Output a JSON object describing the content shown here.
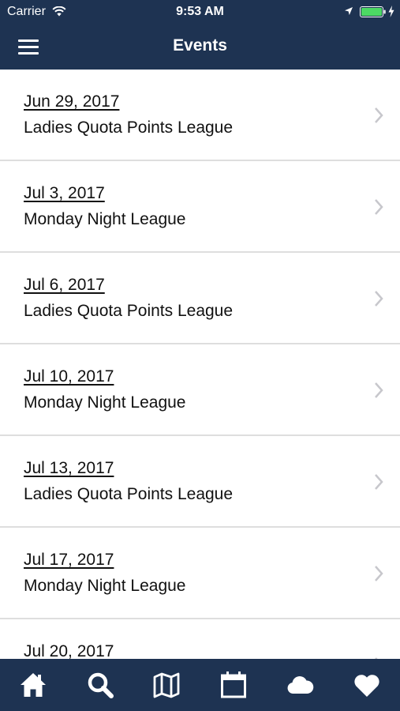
{
  "status_bar": {
    "carrier": "Carrier",
    "time": "9:53 AM"
  },
  "nav": {
    "title": "Events",
    "menu_icon": "hamburger-menu-icon"
  },
  "events": [
    {
      "date": "Jun 29, 2017",
      "name": "Ladies Quota Points League"
    },
    {
      "date": "Jul 3, 2017",
      "name": "Monday Night League"
    },
    {
      "date": "Jul 6, 2017",
      "name": "Ladies Quota Points League"
    },
    {
      "date": "Jul 10, 2017",
      "name": "Monday Night League"
    },
    {
      "date": "Jul 13, 2017",
      "name": "Ladies Quota Points League"
    },
    {
      "date": "Jul 17, 2017",
      "name": "Monday Night League"
    },
    {
      "date": "Jul 20, 2017",
      "name": ""
    }
  ],
  "tab_bar": {
    "tabs": [
      {
        "icon": "home-icon"
      },
      {
        "icon": "search-icon"
      },
      {
        "icon": "map-icon"
      },
      {
        "icon": "calendar-icon"
      },
      {
        "icon": "cloud-icon"
      },
      {
        "icon": "heart-icon"
      }
    ]
  },
  "colors": {
    "bar_background": "#1e3352",
    "bar_foreground": "#ffffff",
    "text": "#111111",
    "separator": "#dedede",
    "chevron": "#c7c7cc",
    "battery": "#4cd964"
  }
}
